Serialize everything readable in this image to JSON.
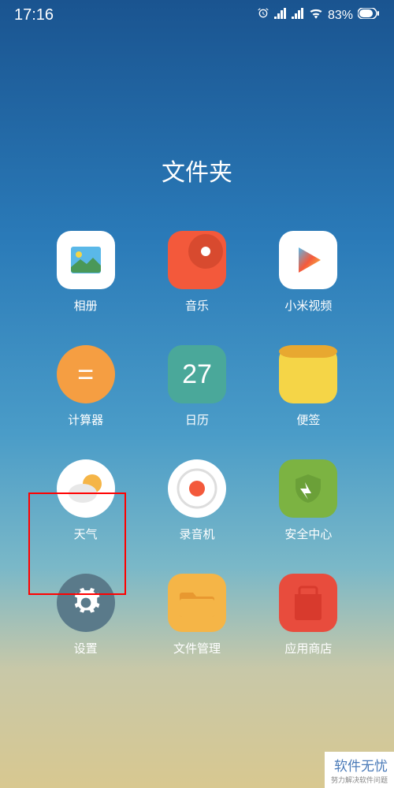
{
  "status": {
    "time": "17:16",
    "battery_pct": "83%"
  },
  "folder": {
    "title": "文件夹"
  },
  "apps": [
    {
      "label": "相册",
      "icon": "gallery-icon"
    },
    {
      "label": "音乐",
      "icon": "music-icon"
    },
    {
      "label": "小米视频",
      "icon": "video-icon"
    },
    {
      "label": "计算器",
      "icon": "calculator-icon"
    },
    {
      "label": "日历",
      "icon": "calendar-icon",
      "day": "27"
    },
    {
      "label": "便签",
      "icon": "notes-icon"
    },
    {
      "label": "天气",
      "icon": "weather-icon"
    },
    {
      "label": "录音机",
      "icon": "recorder-icon"
    },
    {
      "label": "安全中心",
      "icon": "security-icon"
    },
    {
      "label": "设置",
      "icon": "settings-icon"
    },
    {
      "label": "文件管理",
      "icon": "files-icon"
    },
    {
      "label": "应用商店",
      "icon": "appstore-icon"
    }
  ],
  "watermark": {
    "main": "软件无忧",
    "sub": "努力解决软件问题"
  }
}
